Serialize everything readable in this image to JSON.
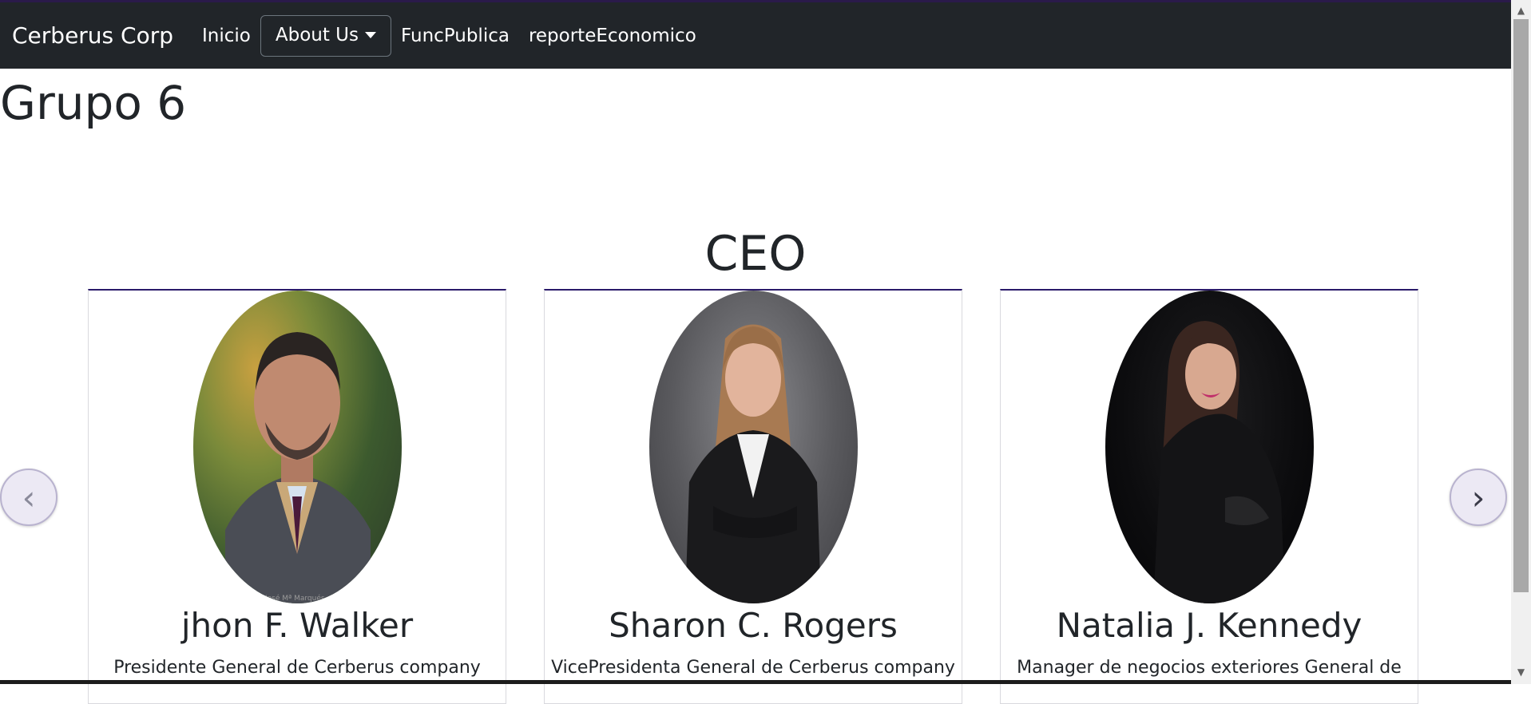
{
  "navbar": {
    "brand": "Cerberus Corp",
    "links": [
      "Inicio",
      "About Us",
      "FuncPublica",
      "reporteEconomico"
    ]
  },
  "page_title": "Grupo 6",
  "section_title": "CEO",
  "carousel": {
    "prev_label": "‹",
    "next_label": "›",
    "cards": [
      {
        "name": "jhon F. Walker",
        "text": "Presidente General de Cerberus company",
        "watermark": "José Mª Marqués"
      },
      {
        "name": "Sharon C. Rogers",
        "text": "VicePresidenta General de Cerberus company"
      },
      {
        "name": "Natalia J. Kennedy",
        "text": "Manager de negocios exteriores General de"
      }
    ]
  },
  "colors": {
    "navbar": "#212529",
    "text": "#212529",
    "card_top_border": "#2a1a6a",
    "carousel_button": "#ece9f4"
  }
}
